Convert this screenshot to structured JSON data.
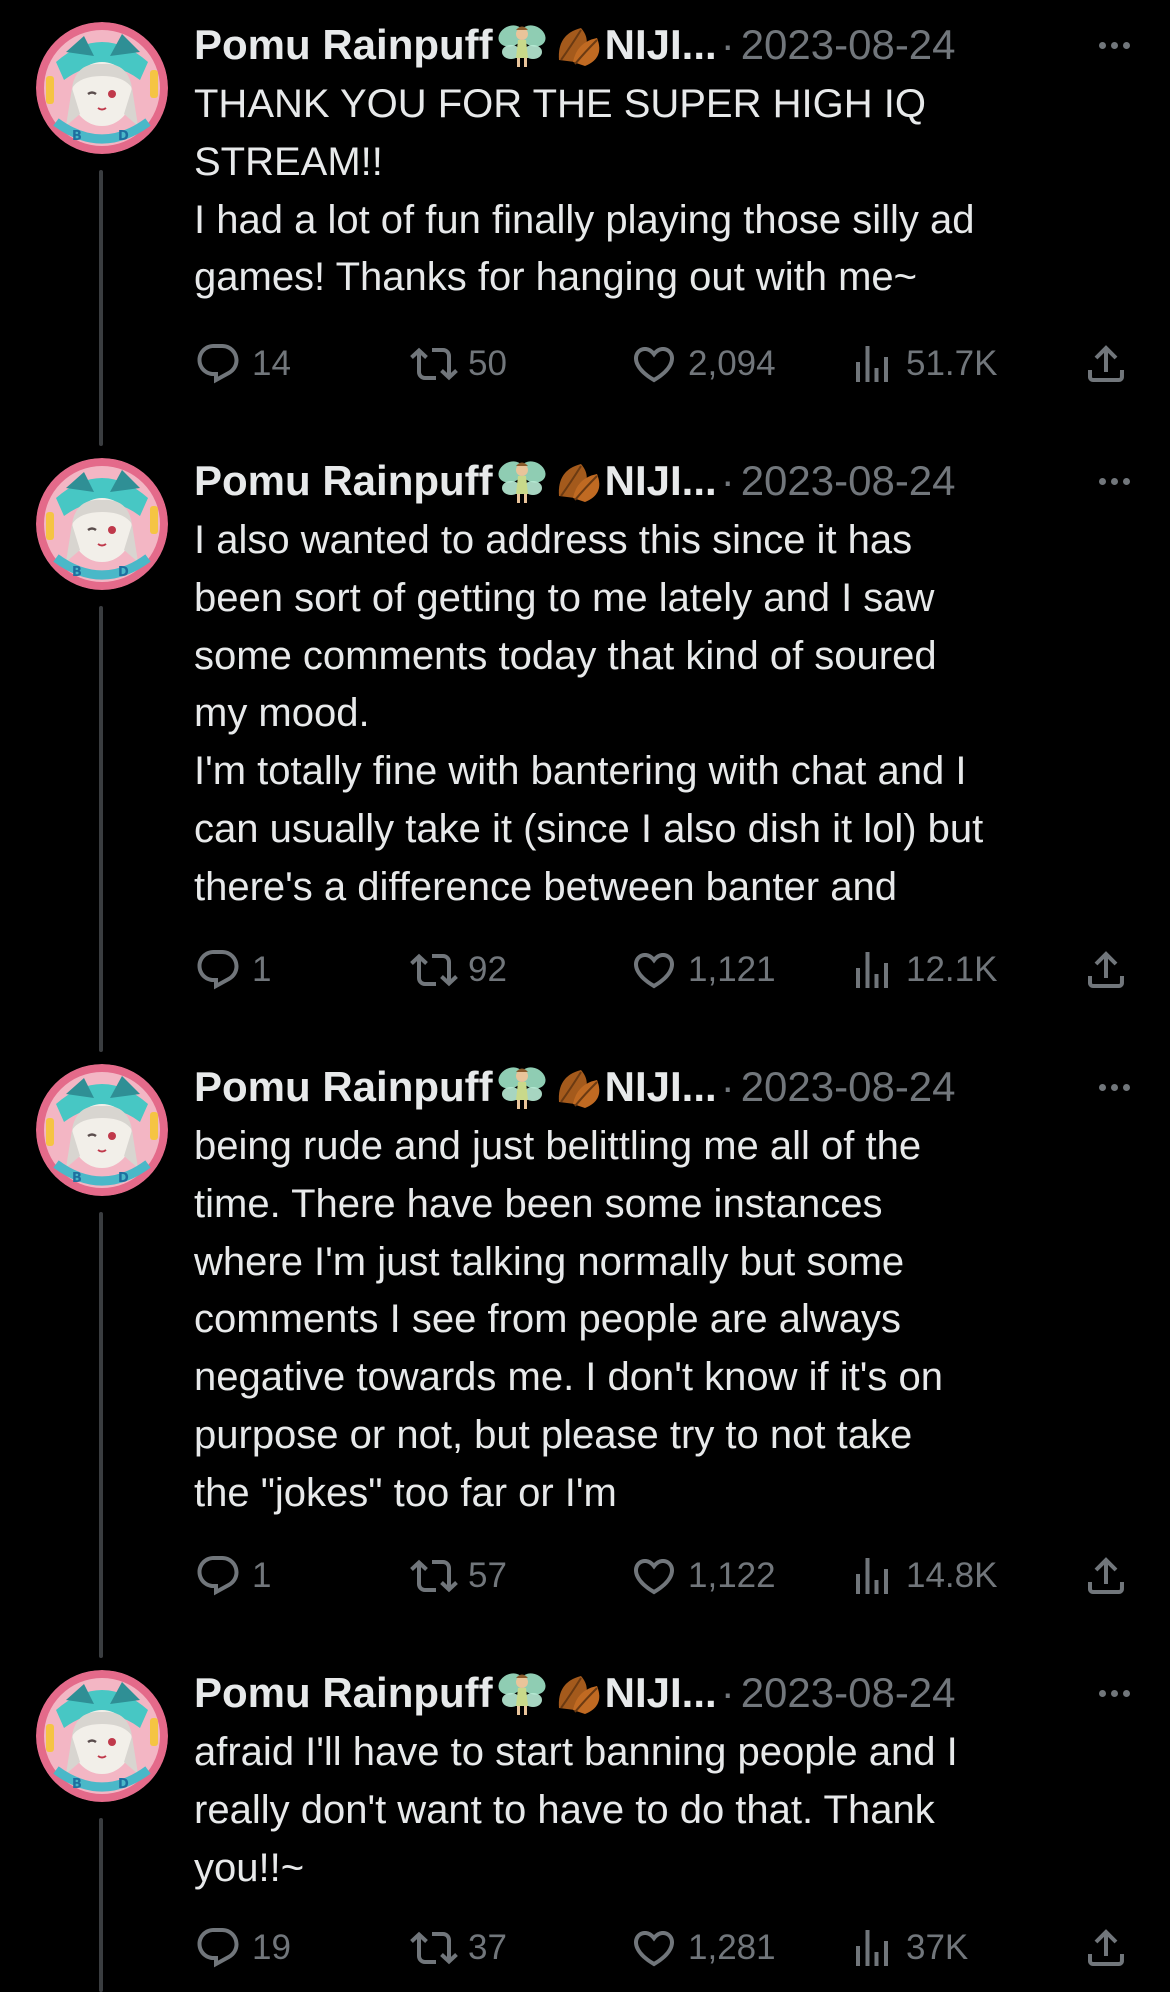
{
  "colors": {
    "background": "#000000",
    "text_primary": "#e7e9ea",
    "text_secondary": "#71767b",
    "thread_line": "#3a3d40"
  },
  "tweets": [
    {
      "author": "Pomu Rainpuff",
      "handle_truncated": "NIJI...",
      "separator": "·",
      "date": "2023-08-24",
      "lines": [
        "THANK YOU FOR THE SUPER HIGH IQ",
        "STREAM!!",
        "I had a lot of fun finally playing those silly ad",
        "games! Thanks for hanging out with me~"
      ],
      "replies": "14",
      "retweets": "50",
      "likes": "2,094",
      "views": "51.7K"
    },
    {
      "author": "Pomu Rainpuff",
      "handle_truncated": "NIJI...",
      "separator": "·",
      "date": "2023-08-24",
      "lines": [
        "I also wanted to address this since it has",
        "been sort of getting to me lately and I saw",
        "some comments today that kind of soured",
        "my mood.",
        "I'm totally fine with bantering with chat and I",
        "can usually take it (since I also dish it lol) but",
        "there's a difference between banter and"
      ],
      "replies": "1",
      "retweets": "92",
      "likes": "1,121",
      "views": "12.1K"
    },
    {
      "author": "Pomu Rainpuff",
      "handle_truncated": "NIJI...",
      "separator": "·",
      "date": "2023-08-24",
      "lines": [
        "being rude and just belittling me all of the",
        "time. There have been some instances",
        "where I'm just talking normally but some",
        "comments I see from people are always",
        "negative towards me. I don't know if it's on",
        "purpose or not, but please try to not take",
        "the \"jokes\" too far or I'm"
      ],
      "replies": "1",
      "retweets": "57",
      "likes": "1,122",
      "views": "14.8K"
    },
    {
      "author": "Pomu Rainpuff",
      "handle_truncated": "NIJI...",
      "separator": "·",
      "date": "2023-08-24",
      "lines": [
        "afraid I'll have to start banning people and I",
        "really don't want to have to do that. Thank",
        "you!!~"
      ],
      "replies": "19",
      "retweets": "37",
      "likes": "1,281",
      "views": "37K"
    }
  ],
  "icons": {
    "reply": "reply-icon",
    "retweet": "retweet-icon",
    "like": "heart-icon",
    "views": "views-icon",
    "share": "share-icon",
    "more": "more-options-icon",
    "emoji_1": "fairy-emoji",
    "emoji_2": "fallen-leaf-emoji"
  }
}
